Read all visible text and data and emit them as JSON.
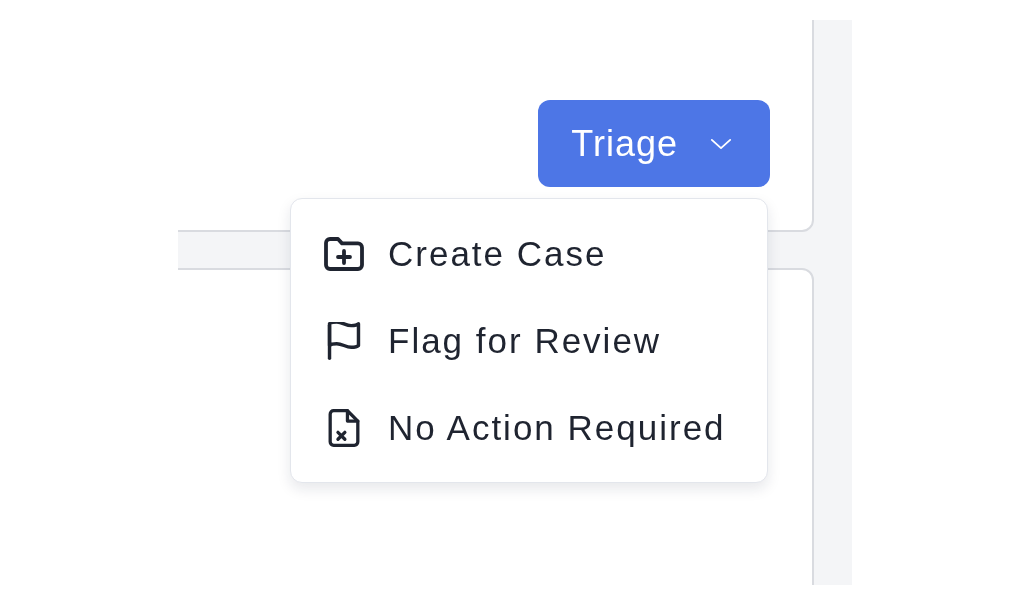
{
  "trigger_button": {
    "label": "Triage",
    "expanded": true
  },
  "menu": {
    "items": [
      {
        "label": "Create Case"
      },
      {
        "label": "Flag for Review"
      },
      {
        "label": "No Action Required"
      }
    ]
  }
}
